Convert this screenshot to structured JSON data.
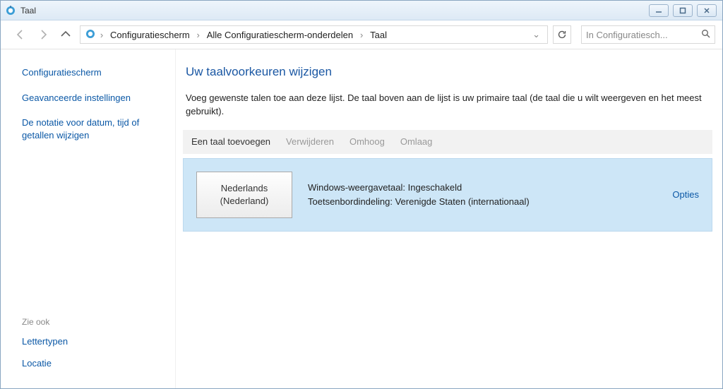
{
  "window": {
    "title": "Taal"
  },
  "nav": {
    "breadcrumbs": [
      "Configuratiescherm",
      "Alle Configuratiescherm-onderdelen",
      "Taal"
    ],
    "search_placeholder": "In Configuratiesch..."
  },
  "sidebar": {
    "links": [
      "Configuratiescherm",
      "Geavanceerde instellingen",
      "De notatie voor datum, tijd of getallen wijzigen"
    ],
    "see_also_heading": "Zie ook",
    "see_also": [
      "Lettertypen",
      "Locatie"
    ]
  },
  "main": {
    "heading": "Uw taalvoorkeuren wijzigen",
    "description": "Voeg gewenste talen toe aan deze lijst. De taal boven aan de lijst is uw primaire taal (de taal die u wilt weergeven en het meest gebruikt).",
    "toolbar": {
      "add": "Een taal toevoegen",
      "remove": "Verwijderen",
      "up": "Omhoog",
      "down": "Omlaag"
    },
    "language": {
      "name_line1": "Nederlands",
      "name_line2": "(Nederland)",
      "display_line": "Windows-weergavetaal: Ingeschakeld",
      "keyboard_line": "Toetsenbordindeling: Verenigde Staten (internationaal)",
      "options_label": "Opties"
    }
  }
}
